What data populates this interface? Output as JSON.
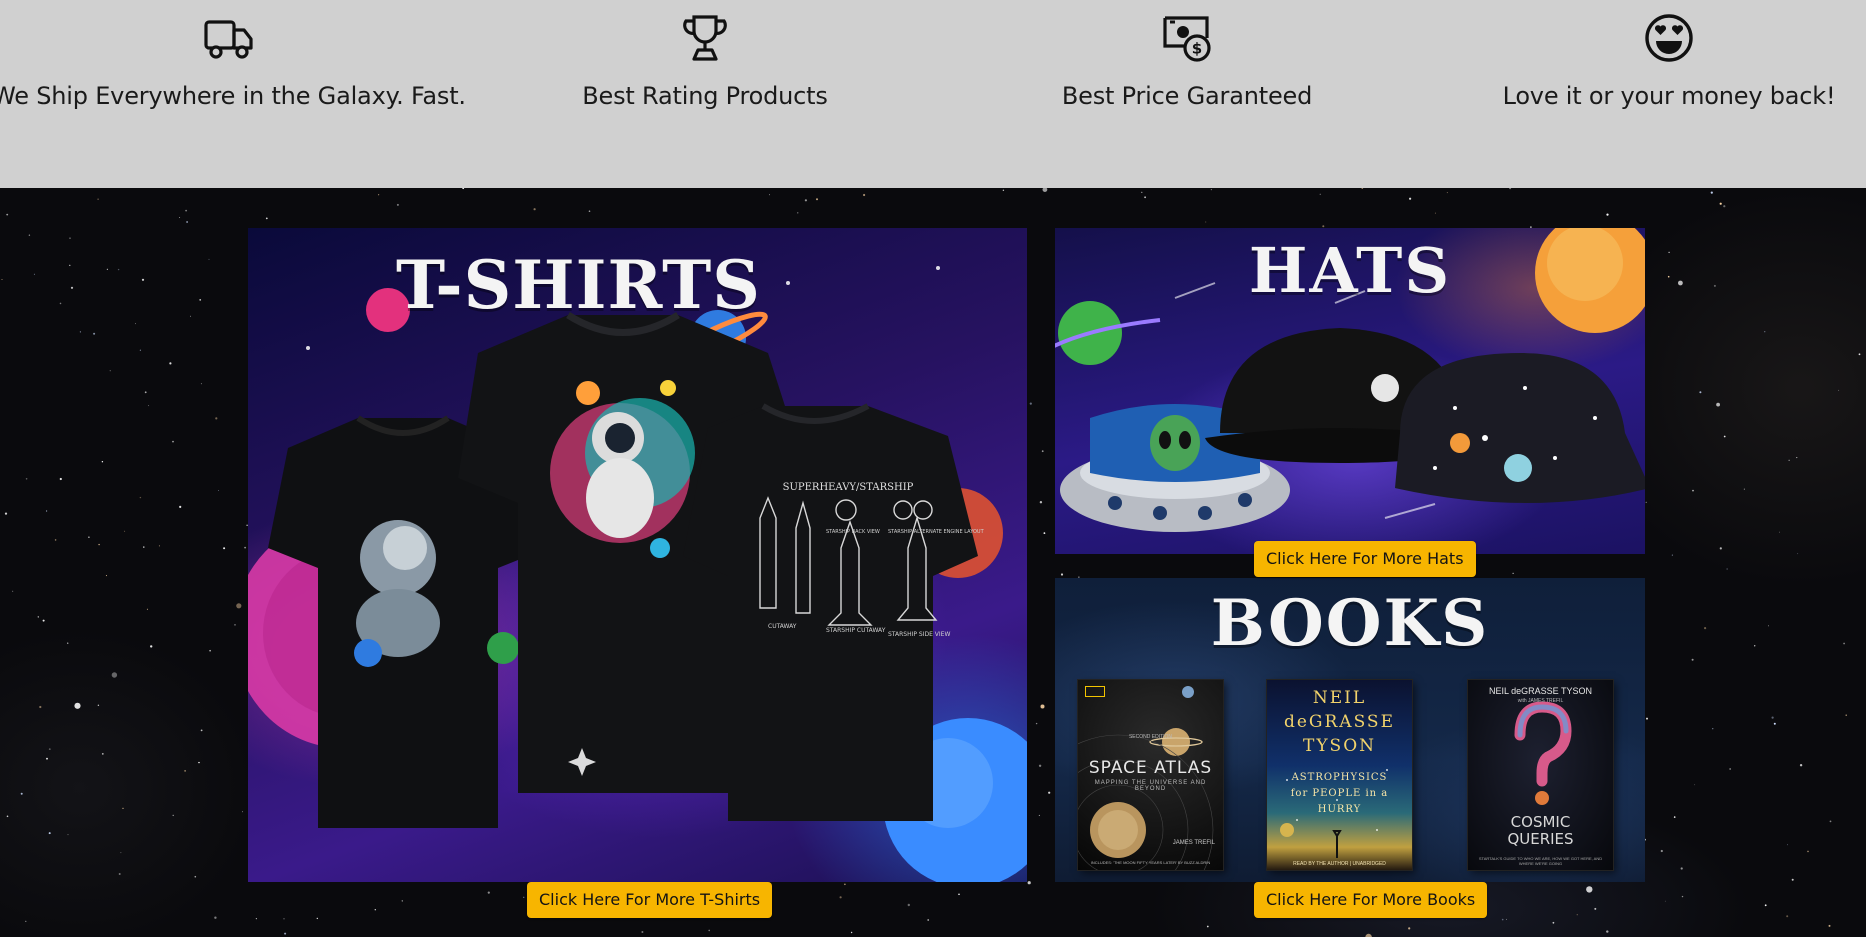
{
  "features": [
    {
      "icon": "delivery-truck-icon",
      "text": "We Ship Everywhere in the Galaxy. Fast."
    },
    {
      "icon": "trophy-icon",
      "text": "Best Rating Products"
    },
    {
      "icon": "money-bill-dollar-icon",
      "text": "Best Price Garanteed"
    },
    {
      "icon": "smiling-face-heart-eyes-icon",
      "text": "Love it or your money back!"
    }
  ],
  "categories": {
    "tshirts": {
      "title": "T-SHIRTS",
      "shirt_print": {
        "header": "SUPERHEAVY/STARSHIP",
        "label1": "CUTAWAY",
        "label2": "STARSHIP CUTAWAY",
        "label3": "STARSHIP SIDE VIEW",
        "label4": "STARSHIP BACK VIEW",
        "label5": "STARSHIP ALTERNATE ENGINE LAYOUT"
      },
      "button": "Click Here For More T-Shirts"
    },
    "hats": {
      "title": "HATS",
      "button": "Click Here For More Hats"
    },
    "books": {
      "title": "BOOKS",
      "covers": [
        {
          "publisher": "NATIONAL GEOGRAPHIC",
          "edition": "SECOND EDITION",
          "title": "SPACE ATLAS",
          "subtitle": "MAPPING THE UNIVERSE AND BEYOND",
          "author": "JAMES TREFIL",
          "footer": "INCLUDES: 'THE MOON FIFTY YEARS LATER' BY BUZZ ALDRIN"
        },
        {
          "author": "NEIL deGRASSE TYSON",
          "title": "ASTROPHYSICS for PEOPLE in a HURRY",
          "footer": "READ BY THE AUTHOR | UNABRIDGED"
        },
        {
          "author": "NEIL deGRASSE TYSON",
          "coauthor": "with JAMES TREFIL",
          "title": "COSMIC QUERIES",
          "footer": "STARTALK'S GUIDE TO WHO WE ARE, HOW WE GOT HERE, AND WHERE WE'RE GOING"
        }
      ],
      "button": "Click Here For More Books"
    }
  },
  "colors": {
    "feature_bar": "#d0d0d0",
    "button_bg": "#f7b500",
    "button_text": "#141414"
  }
}
